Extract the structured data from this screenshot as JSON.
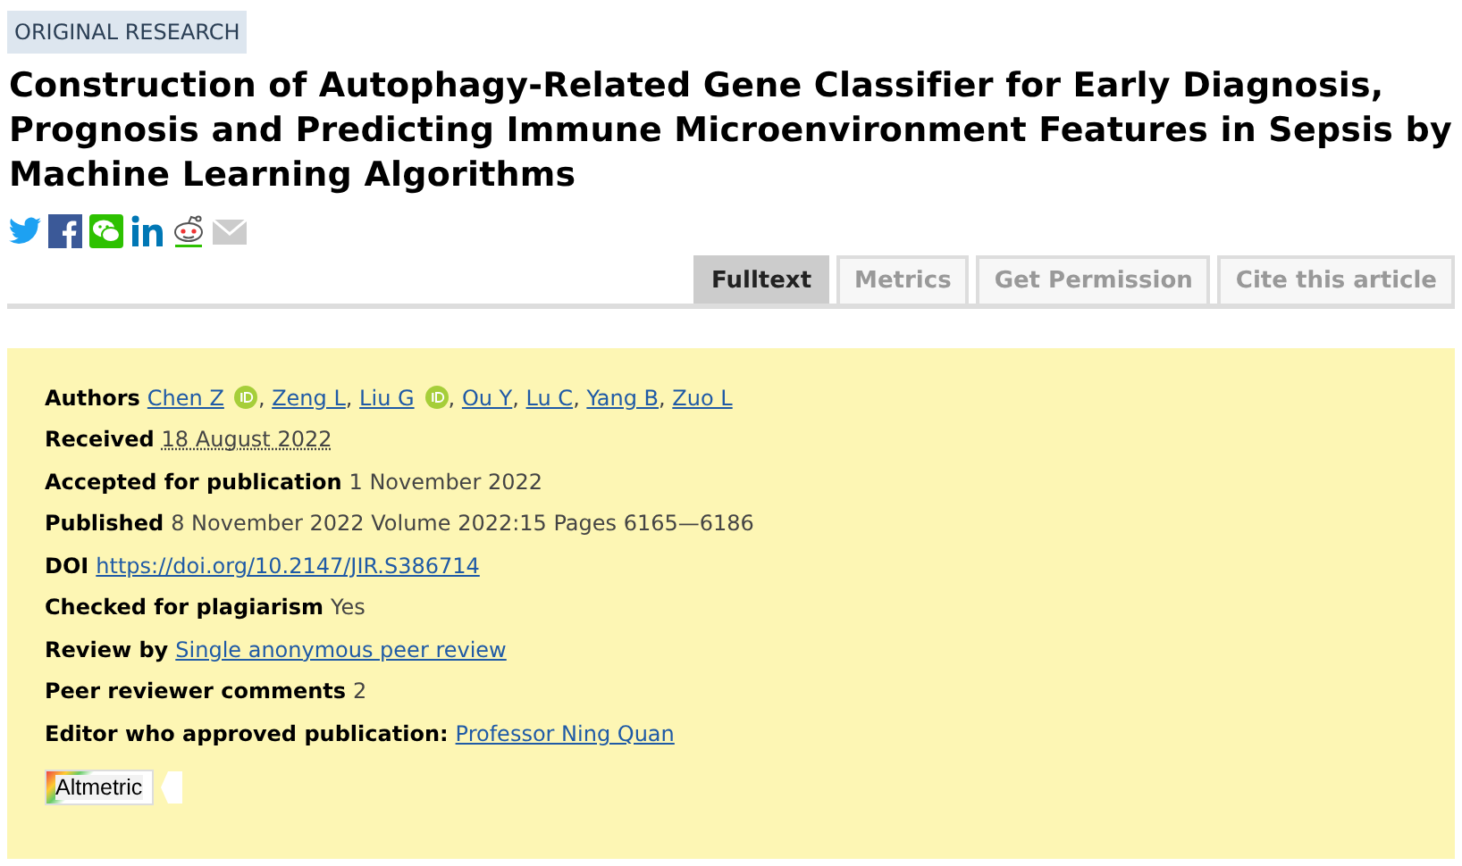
{
  "article_type": "ORIGINAL RESEARCH",
  "title": "Construction of Autophagy-Related Gene Classifier for Early Diagnosis, Prognosis and Predicting Immune Microenvironment Features in Sepsis by Machine Learning Algorithms",
  "tabs": [
    {
      "label": "Fulltext",
      "selected": true
    },
    {
      "label": "Metrics",
      "selected": false
    },
    {
      "label": "Get Permission",
      "selected": false
    },
    {
      "label": "Cite this article",
      "selected": false
    }
  ],
  "authors": {
    "label": "Authors",
    "separator": ", ",
    "names": [
      {
        "name": "Chen Z",
        "orcid": true
      },
      {
        "name": "Zeng L",
        "orcid": false
      },
      {
        "name": "Liu G",
        "orcid": true
      },
      {
        "name": "Ou Y",
        "orcid": false
      },
      {
        "name": "Lu C",
        "orcid": false
      },
      {
        "name": "Yang B",
        "orcid": false
      },
      {
        "name": "Zuo L",
        "orcid": false
      }
    ]
  },
  "details": [
    {
      "label": "Received",
      "kind": "date",
      "value": "18 August 2022"
    },
    {
      "label": "Accepted for publication",
      "kind": "text",
      "value": "1 November 2022"
    },
    {
      "label": "Published",
      "kind": "text",
      "value": "8 November 2022 Volume 2022:15 Pages 6165—6186"
    },
    {
      "label": "DOI",
      "kind": "link",
      "value": "https://doi.org/10.2147/JIR.S386714"
    },
    {
      "label": "Checked for plagiarism",
      "kind": "text",
      "value": "Yes"
    },
    {
      "label": "Review by",
      "kind": "link",
      "value": "Single anonymous peer review"
    },
    {
      "label": "Peer reviewer comments",
      "kind": "text",
      "value": "2"
    },
    {
      "label": "Editor who approved publication:",
      "kind": "link",
      "value": "Professor Ning Quan"
    }
  ],
  "altmetric": {
    "label": "Altmetric"
  }
}
